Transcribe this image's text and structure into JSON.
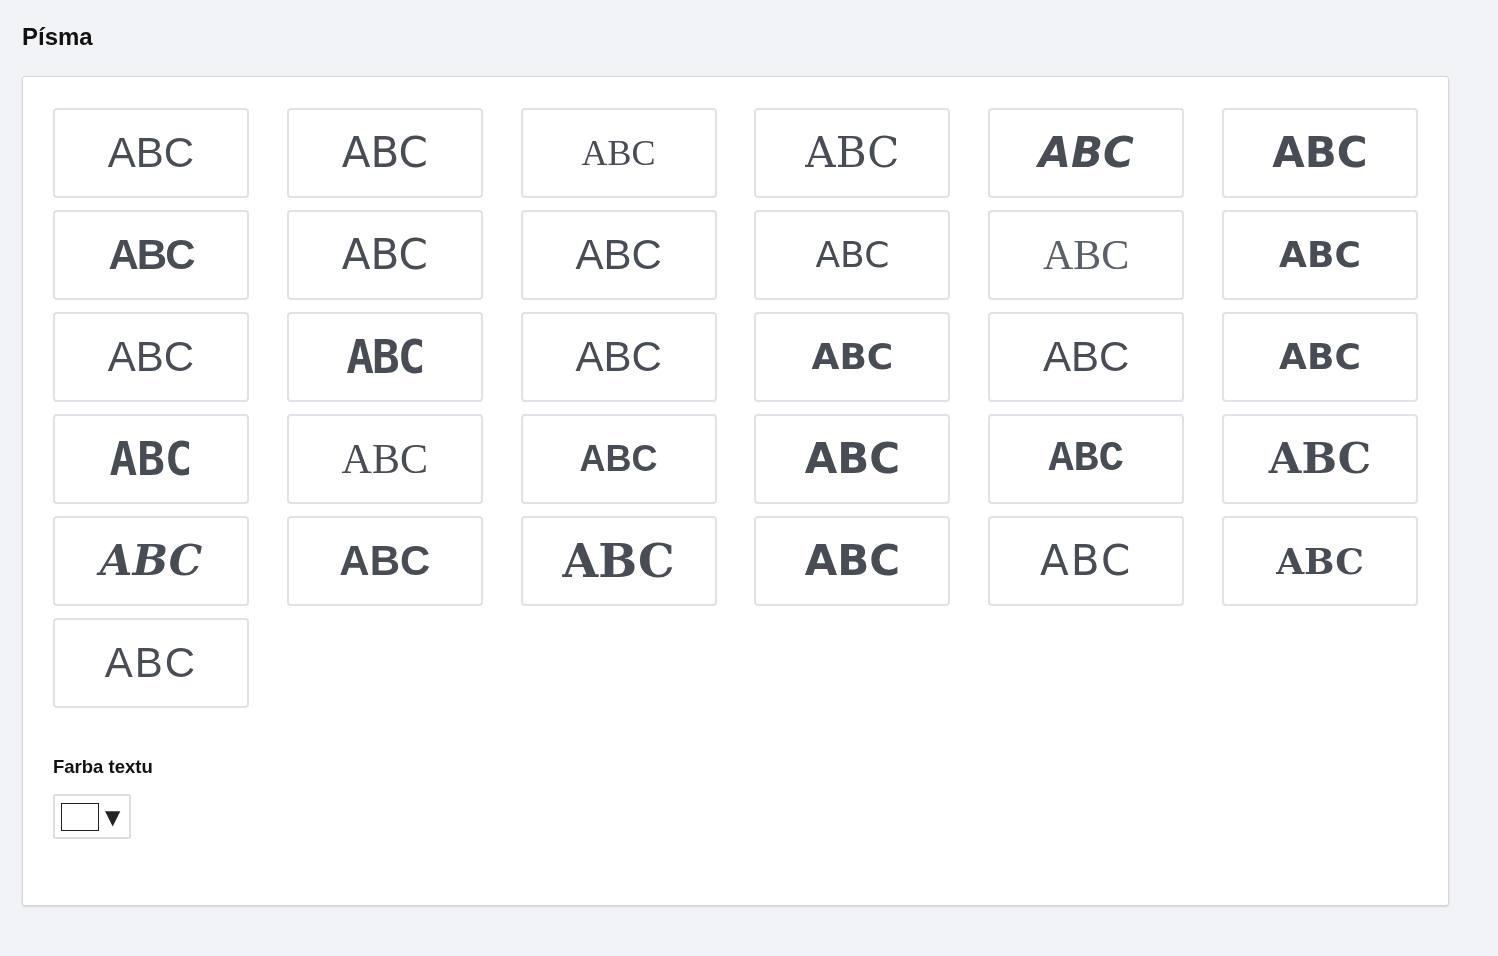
{
  "section": {
    "title": "Písma"
  },
  "fonts": [
    {
      "sample": "ABC",
      "selected": false
    },
    {
      "sample": "ABC",
      "selected": false
    },
    {
      "sample": "ABC",
      "selected": false
    },
    {
      "sample": "ABC",
      "selected": false
    },
    {
      "sample": "ABC",
      "selected": false
    },
    {
      "sample": "ABC",
      "selected": false
    },
    {
      "sample": "ABC",
      "selected": false
    },
    {
      "sample": "ABC",
      "selected": false
    },
    {
      "sample": "ABC",
      "selected": false
    },
    {
      "sample": "ABC",
      "selected": false
    },
    {
      "sample": "ABC",
      "selected": false
    },
    {
      "sample": "ABC",
      "selected": false
    },
    {
      "sample": "ABC",
      "selected": false
    },
    {
      "sample": "ABC",
      "selected": false
    },
    {
      "sample": "ABC",
      "selected": false
    },
    {
      "sample": "ABC",
      "selected": false
    },
    {
      "sample": "ABC",
      "selected": false
    },
    {
      "sample": "ABC",
      "selected": false
    },
    {
      "sample": "ABC",
      "selected": false
    },
    {
      "sample": "ABC",
      "selected": false
    },
    {
      "sample": "ABC",
      "selected": false
    },
    {
      "sample": "ABC",
      "selected": false
    },
    {
      "sample": "ABC",
      "selected": false
    },
    {
      "sample": "ABC",
      "selected": false
    },
    {
      "sample": "ABC",
      "selected": false
    },
    {
      "sample": "ABC",
      "selected": false
    },
    {
      "sample": "ABC",
      "selected": false
    },
    {
      "sample": "ABC",
      "selected": false
    },
    {
      "sample": "ABC",
      "selected": false
    },
    {
      "sample": "ABC",
      "selected": false
    },
    {
      "sample": "ABC",
      "selected": false
    }
  ],
  "text_color": {
    "label": "Farba textu",
    "color": "#ffffff",
    "arrow": "▼"
  }
}
